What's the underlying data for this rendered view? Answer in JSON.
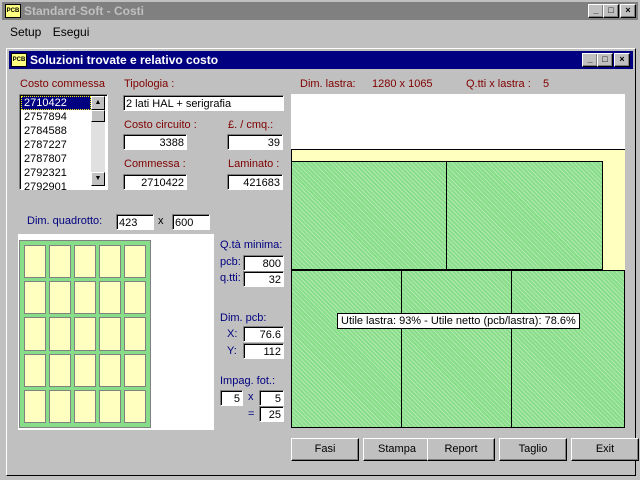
{
  "app": {
    "title": "Standard-Soft  -  Costi",
    "icon_text": "PCB",
    "menu": [
      "Setup",
      "Esegui"
    ]
  },
  "window": {
    "title": "Soluzioni trovate e relativo costo",
    "controls": [
      "_",
      "□",
      "×"
    ]
  },
  "costo_commessa": {
    "label": "Costo commessa",
    "items": [
      "2710422",
      "2757894",
      "2784588",
      "2787227",
      "2787807",
      "2792321",
      "2792901"
    ],
    "selected_index": 0
  },
  "tipologia": {
    "label": "Tipologia :",
    "value": "2 lati HAL + serigrafia"
  },
  "costo_circuito": {
    "label": "Costo circuito :",
    "value": "3388"
  },
  "lire_cmq": {
    "label": "£. / cmq.:",
    "value": "39"
  },
  "commessa": {
    "label": "Commessa :",
    "value": "2710422"
  },
  "laminato": {
    "label": "Laminato :",
    "value": "421683"
  },
  "dim_lastra": {
    "label": "Dim. lastra:",
    "value": "1280  x 1065"
  },
  "qtti_lastra": {
    "label": "Q.tti x lastra :",
    "value": "5"
  },
  "dim_quadrotto": {
    "label": "Dim. quadrotto:",
    "w": "423",
    "x": "x",
    "h": "600"
  },
  "qta_minima": {
    "label": "Q.tà minima:",
    "pcb_label": "pcb:",
    "pcb": "800",
    "qtti_label": "q.tti:",
    "qtti": "32"
  },
  "dim_pcb": {
    "label": "Dim. pcb:",
    "x_label": "X:",
    "x": "76.6",
    "y_label": "Y:",
    "y": "112"
  },
  "impag": {
    "label": "Impag. fot.:",
    "a": "5",
    "times": "x",
    "b": "5",
    "eq": "=",
    "total": "25"
  },
  "utile": {
    "text": "Utile lastra:  93%  -  Utile netto (pcb/lastra):  78.6%"
  },
  "buttons": {
    "fasi": "Fasi",
    "stampa": "Stampa",
    "report": "Report",
    "taglio": "Taglio",
    "exit": "Exit"
  },
  "colors": {
    "title_active": "#000080",
    "panel_green": "#88dd88",
    "cell_yellow": "#ffffc0"
  }
}
